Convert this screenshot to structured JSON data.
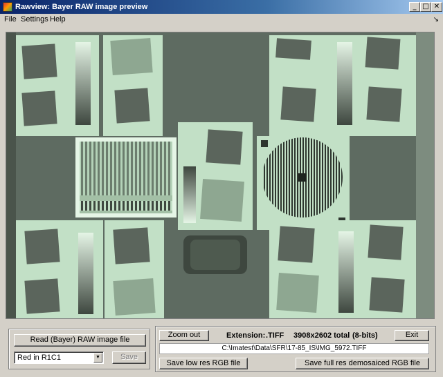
{
  "window": {
    "title": "Rawview: Bayer RAW image preview",
    "minimize_glyph": "_",
    "maximize_glyph": "□",
    "close_glyph": "✕"
  },
  "menu": {
    "file": "File",
    "settings": "Settings",
    "help": "Help",
    "dock_glyph": "↘"
  },
  "left_panel": {
    "read_button": "Read (Bayer) RAW image file",
    "channel_select": {
      "value": "Red in R1C1",
      "arrow": "▼"
    },
    "save_button": "Save"
  },
  "right_panel": {
    "zoom_button": "Zoom out",
    "extension_label": "Extension:",
    "extension_value": ".TIFF",
    "size_text": "3908x2602 total",
    "bits_text": "(8-bits)",
    "exit_button": "Exit",
    "file_path": "C:\\Imatest\\Data\\SFR\\17-85_IS\\IMG_5972.TIFF",
    "save_low_button": "Save low res RGB file",
    "save_full_button": "Save full res demosaiced RGB file"
  },
  "colors": {
    "chart_light": "#c2e0c6",
    "chart_dark": "#5b655c",
    "chart_mid": "#8ea791",
    "background": "#5e6b61"
  }
}
